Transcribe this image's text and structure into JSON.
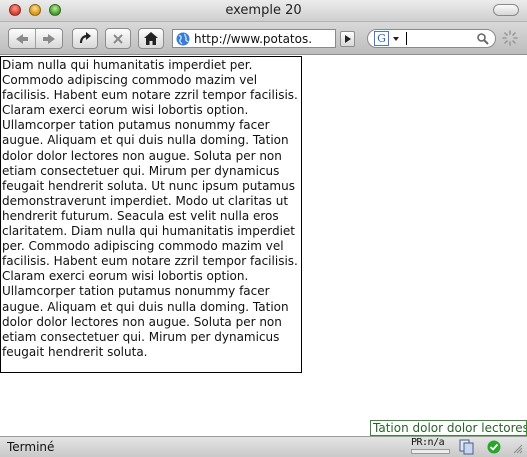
{
  "window": {
    "title": "exemple 20"
  },
  "toolbar": {
    "url": "http://www.potatos.",
    "search_placeholder": "",
    "back_icon": "back-arrow-icon",
    "forward_icon": "forward-arrow-icon",
    "reload_icon": "reload-icon",
    "stop_icon": "stop-icon",
    "home_icon": "home-icon"
  },
  "content": {
    "paragraphs": [
      "Diam nulla qui humanitatis imperdiet per. Commodo adipiscing commodo mazim vel facilisis. Habent eum notare zzril tempor facilisis. Claram exerci eorum wisi lobortis option. Ullamcorper tation putamus nonummy facer augue. Aliquam et qui duis nulla doming. Tation dolor dolor lectores non augue. Soluta per non etiam consectetuer qui. Mirum per dynamicus feugait hendrerit soluta. Ut nunc ipsum putamus demonstraverunt imperdiet. Modo ut claritas ut hendrerit futurum. Seacula est velit nulla eros claritatem. Diam nulla qui humanitatis imperdiet per. Commodo adipiscing commodo mazim vel facilisis. Habent eum notare zzril tempor facilisis. Claram exerci eorum wisi lobortis option. Ullamcorper tation putamus nonummy facer augue. Aliquam et qui duis nulla doming. Tation dolor dolor lectores non augue. Soluta per non etiam consectetuer qui. Mirum per dynamicus feugait hendrerit soluta."
    ]
  },
  "tooltip": {
    "text": "Tation dolor dolor lectores"
  },
  "status": {
    "text": "Terminé",
    "pr_label": "PR:n/a"
  },
  "colors": {
    "tooltip_border": "#3a8a3a",
    "status_ok": "#2aa52a"
  }
}
